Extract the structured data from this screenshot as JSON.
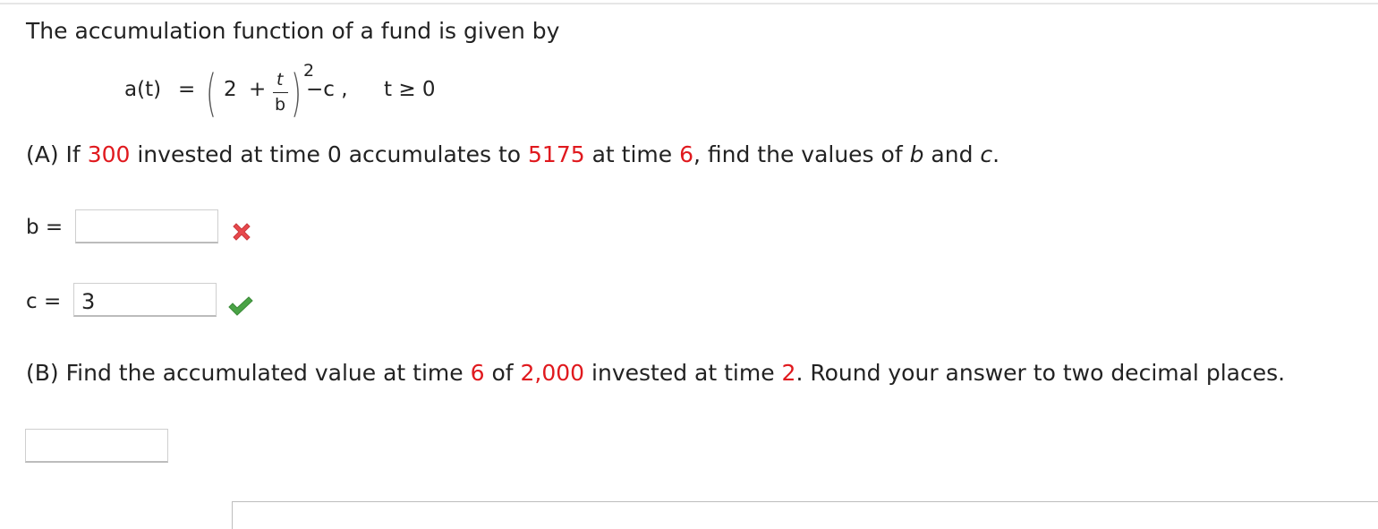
{
  "intro": "The accumulation function of a fund is given by",
  "formula": {
    "lhs": "a(t)",
    "eq": "=",
    "two": "2",
    "plus": "+",
    "frac_num": "t",
    "frac_den": "b",
    "exponent": "2",
    "minus_c": "−c ,",
    "condition": "t ≥ 0"
  },
  "part_a": {
    "prefix": "(A) If ",
    "amount1": "300",
    "mid1": " invested at time 0 accumulates to ",
    "amount2": "5175",
    "mid2": " at time ",
    "time": "6",
    "mid3": ", find the values of ",
    "var_b": "b",
    "and": " and ",
    "var_c": "c",
    "end": "."
  },
  "answers": {
    "b_label": "b  =",
    "b_value": "",
    "b_status": "incorrect",
    "c_label": "c  =",
    "c_value": "3",
    "c_status": "correct"
  },
  "part_b": {
    "prefix": "(B) Find the accumulated value at time ",
    "time1": "6",
    "mid1": " of ",
    "amount": "2,000",
    "mid2": " invested at time ",
    "time2": "2",
    "end": ". Round your answer to two decimal places.",
    "answer_value": ""
  },
  "colors": {
    "highlight": "#e0191e",
    "incorrect": "#e8484c",
    "correct": "#4aa346"
  },
  "icons": {
    "incorrect": "x-mark-icon",
    "correct": "check-mark-icon"
  }
}
